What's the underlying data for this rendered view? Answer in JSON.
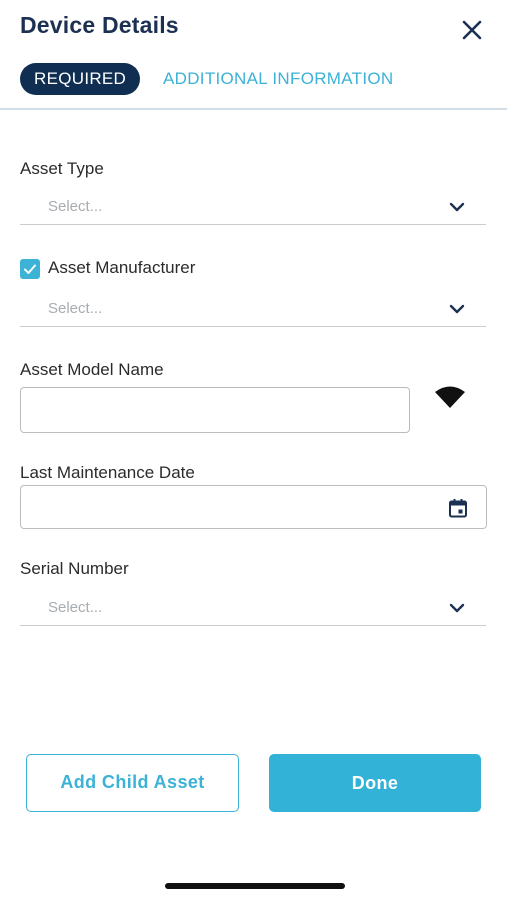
{
  "header": {
    "title": "Device Details",
    "close_icon": "close-icon"
  },
  "tabs": [
    {
      "label": "REQUIRED",
      "active": true
    },
    {
      "label": "ADDITIONAL INFORMATION",
      "active": false
    }
  ],
  "fields": {
    "asset_type": {
      "label": "Asset Type",
      "placeholder": "Select...",
      "icon": "chevron-down-icon"
    },
    "asset_manufacturer": {
      "label": "Asset Manufacturer",
      "checked": true,
      "placeholder": "Select...",
      "icon": "chevron-down-icon"
    },
    "asset_model_name": {
      "label": "Asset Model Name",
      "value": "",
      "side_icon": "wifi-icon"
    },
    "last_maintenance_date": {
      "label": "Last Maintenance Date",
      "value": "",
      "icon": "calendar-icon"
    },
    "serial_number": {
      "label": "Serial Number",
      "placeholder": "Select...",
      "icon": "chevron-down-icon"
    }
  },
  "actions": {
    "add_child_asset": "Add Child Asset",
    "done": "Done"
  },
  "colors": {
    "title": "#1c3152",
    "tab_active_bg": "#0f2e52",
    "accent": "#3bb2d6",
    "primary_button": "#33b2d8",
    "placeholder": "#a7acb1"
  }
}
